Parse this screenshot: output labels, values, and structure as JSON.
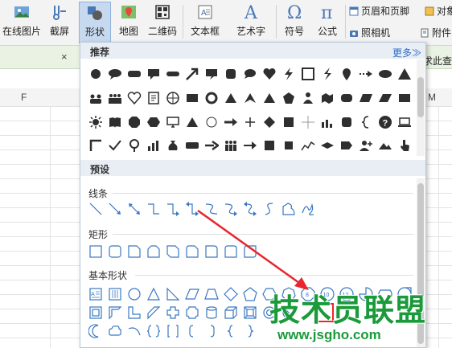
{
  "ribbon": {
    "online_pic": "在线图片",
    "screenshot": "截屏",
    "shapes": "形状",
    "map": "地图",
    "qrcode": "二维码",
    "textbox": "文本框",
    "wordart": "艺术字",
    "symbol": "符号",
    "formula": "公式",
    "header_footer": "页眉和页脚",
    "object": "对象",
    "camera": "照相机",
    "attachment": "附件",
    "accent_color": "#3b6fb6"
  },
  "tabbar": {
    "close_glyph": "×",
    "right_text": "求此查"
  },
  "sheet": {
    "col_f": "F",
    "col_m": "M"
  },
  "panel": {
    "recommended": "推荐",
    "more": "更多≫",
    "preset": "预设",
    "lines": "线条",
    "rectangles": "矩形",
    "basic_shapes": "基本形状"
  },
  "watermark": {
    "brand": "技术员联盟",
    "url": "www.jsgho.com"
  },
  "colors": {
    "arrow": "#e8262e",
    "shape_fill": "#2f2f2f",
    "preset_outline": "#3a78c2",
    "watermark_green": "#1a9a3a",
    "watermark_red": "#d9251c"
  }
}
